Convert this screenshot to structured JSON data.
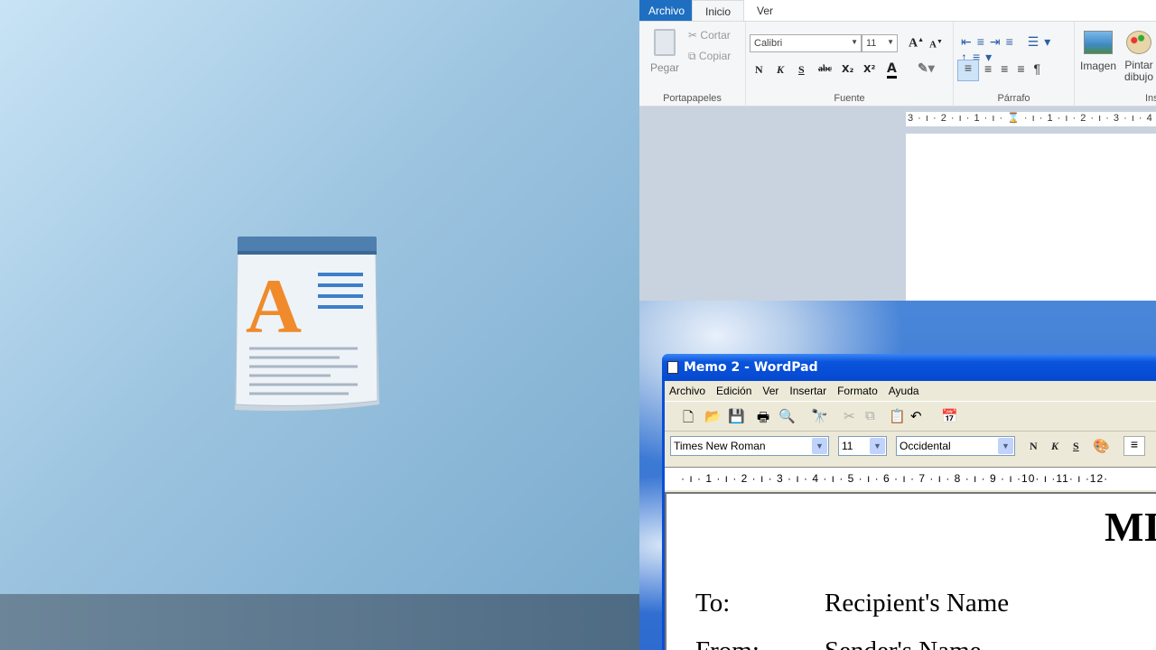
{
  "new_wordpad": {
    "tabs": [
      "Archivo",
      "Inicio",
      "Ver"
    ],
    "clipboard": {
      "paste": "Pegar",
      "cut": "Cortar",
      "copy": "Copiar",
      "label": "Portapapeles"
    },
    "font": {
      "family": "Calibri",
      "size": "11",
      "label": "Fuente",
      "bold": "N",
      "italic": "K",
      "underline": "S",
      "strike": "abc",
      "sub": "X₂",
      "sup": "X²",
      "color": "A"
    },
    "paragraph": {
      "label": "Párrafo"
    },
    "insert": {
      "image": "Imagen",
      "paint": "Pintar dibujo",
      "label": "Ins"
    },
    "ruler": "3 · ı · 2 · ı · 1 · ı · ⌛ · ı · 1 · ı · 2 · ı · 3 · ı · 4",
    "accent": "#1e6fc1"
  },
  "old_wordpad": {
    "title": "Memo 2 - WordPad",
    "menu": [
      "Archivo",
      "Edición",
      "Ver",
      "Insertar",
      "Formato",
      "Ayuda"
    ],
    "font": "Times New Roman",
    "size": "11",
    "script": "Occidental",
    "bold": "N",
    "italic": "K",
    "underline": "S",
    "ruler": "· ı · 1 · ı · 2 · ı · 3 · ı · 4 · ı · 5 · ı · 6 · ı · 7 · ı · 8 · ı · 9 · ı ·10· ı ·11· ı ·12·",
    "doc": {
      "heading": "MI",
      "to_label": "To:",
      "to_value": "Recipient's Name",
      "from_label": "From:",
      "from_value": "Sender's Name"
    },
    "title_color": "#0a54dc"
  }
}
